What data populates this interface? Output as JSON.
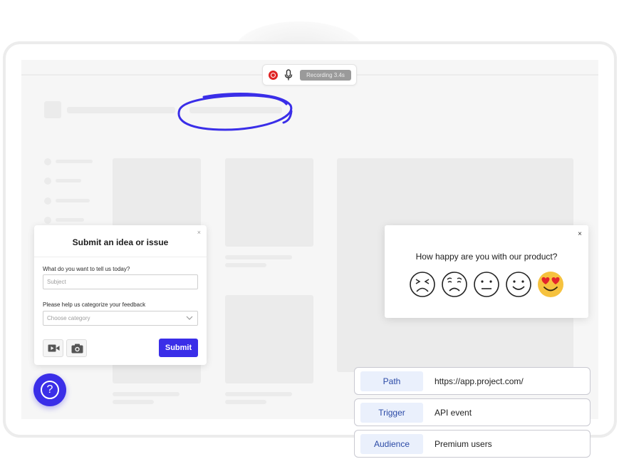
{
  "recording": {
    "status": "Recording 3.4s"
  },
  "feedback_form": {
    "title": "Submit an idea or issue",
    "close": "×",
    "question_label": "What do you want to tell us today?",
    "subject_placeholder": "Subject",
    "category_label": "Please help us categorize your feedback",
    "category_placeholder": "Choose category",
    "submit_label": "Submit"
  },
  "help_button": {
    "glyph": "?"
  },
  "survey": {
    "close": "×",
    "question": "How happy are you with our product?",
    "options": [
      "very-unhappy-face-icon",
      "unhappy-face-icon",
      "neutral-face-icon",
      "happy-face-icon",
      "heart-eyes-face-icon"
    ],
    "selected_index": 4
  },
  "targeting": [
    {
      "key": "Path",
      "value": "https://app.project.com/"
    },
    {
      "key": "Trigger",
      "value": "API event"
    },
    {
      "key": "Audience",
      "value": "Premium users"
    }
  ],
  "colors": {
    "accent": "#3a2ee8",
    "record_red": "#e02424",
    "tag_bg": "#eaf0fc",
    "tag_text": "#2b4aa6",
    "emoji_yellow": "#f6c23e",
    "heart_red": "#e3242b"
  }
}
